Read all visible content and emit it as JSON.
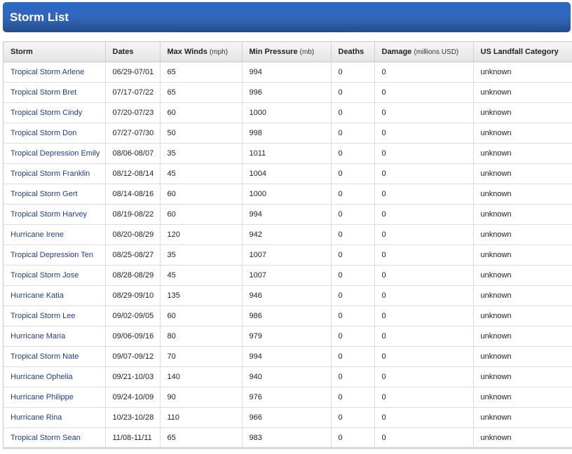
{
  "header": {
    "title": "Storm List"
  },
  "columns": [
    {
      "label": "Storm",
      "unit": ""
    },
    {
      "label": "Dates",
      "unit": ""
    },
    {
      "label": "Max Winds",
      "unit": "(mph)"
    },
    {
      "label": "Min Pressure",
      "unit": "(mb)"
    },
    {
      "label": "Deaths",
      "unit": ""
    },
    {
      "label": "Damage",
      "unit": "(millions USD)"
    },
    {
      "label": "US Landfall Category",
      "unit": ""
    }
  ],
  "rows": [
    {
      "storm": "Tropical Storm Arlene",
      "dates": "06/29-07/01",
      "winds": "65",
      "pressure": "994",
      "deaths": "0",
      "damage": "0",
      "landfall": "unknown"
    },
    {
      "storm": "Tropical Storm Bret",
      "dates": "07/17-07/22",
      "winds": "65",
      "pressure": "996",
      "deaths": "0",
      "damage": "0",
      "landfall": "unknown"
    },
    {
      "storm": "Tropical Storm Cindy",
      "dates": "07/20-07/23",
      "winds": "60",
      "pressure": "1000",
      "deaths": "0",
      "damage": "0",
      "landfall": "unknown"
    },
    {
      "storm": "Tropical Storm Don",
      "dates": "07/27-07/30",
      "winds": "50",
      "pressure": "998",
      "deaths": "0",
      "damage": "0",
      "landfall": "unknown"
    },
    {
      "storm": "Tropical Depression Emily",
      "dates": "08/06-08/07",
      "winds": "35",
      "pressure": "1011",
      "deaths": "0",
      "damage": "0",
      "landfall": "unknown"
    },
    {
      "storm": "Tropical Storm Franklin",
      "dates": "08/12-08/14",
      "winds": "45",
      "pressure": "1004",
      "deaths": "0",
      "damage": "0",
      "landfall": "unknown"
    },
    {
      "storm": "Tropical Storm Gert",
      "dates": "08/14-08/16",
      "winds": "60",
      "pressure": "1000",
      "deaths": "0",
      "damage": "0",
      "landfall": "unknown"
    },
    {
      "storm": "Tropical Storm Harvey",
      "dates": "08/19-08/22",
      "winds": "60",
      "pressure": "994",
      "deaths": "0",
      "damage": "0",
      "landfall": "unknown"
    },
    {
      "storm": "Hurricane Irene",
      "dates": "08/20-08/29",
      "winds": "120",
      "pressure": "942",
      "deaths": "0",
      "damage": "0",
      "landfall": "unknown"
    },
    {
      "storm": "Tropical Depression Ten",
      "dates": "08/25-08/27",
      "winds": "35",
      "pressure": "1007",
      "deaths": "0",
      "damage": "0",
      "landfall": "unknown"
    },
    {
      "storm": "Tropical Storm Jose",
      "dates": "08/28-08/29",
      "winds": "45",
      "pressure": "1007",
      "deaths": "0",
      "damage": "0",
      "landfall": "unknown"
    },
    {
      "storm": "Hurricane Katia",
      "dates": "08/29-09/10",
      "winds": "135",
      "pressure": "946",
      "deaths": "0",
      "damage": "0",
      "landfall": "unknown"
    },
    {
      "storm": "Tropical Storm Lee",
      "dates": "09/02-09/05",
      "winds": "60",
      "pressure": "986",
      "deaths": "0",
      "damage": "0",
      "landfall": "unknown"
    },
    {
      "storm": "Hurricane Maria",
      "dates": "09/06-09/16",
      "winds": "80",
      "pressure": "979",
      "deaths": "0",
      "damage": "0",
      "landfall": "unknown"
    },
    {
      "storm": "Tropical Storm Nate",
      "dates": "09/07-09/12",
      "winds": "70",
      "pressure": "994",
      "deaths": "0",
      "damage": "0",
      "landfall": "unknown"
    },
    {
      "storm": "Hurricane Ophelia",
      "dates": "09/21-10/03",
      "winds": "140",
      "pressure": "940",
      "deaths": "0",
      "damage": "0",
      "landfall": "unknown"
    },
    {
      "storm": "Hurricane Philippe",
      "dates": "09/24-10/09",
      "winds": "90",
      "pressure": "976",
      "deaths": "0",
      "damage": "0",
      "landfall": "unknown"
    },
    {
      "storm": "Hurricane Rina",
      "dates": "10/23-10/28",
      "winds": "110",
      "pressure": "966",
      "deaths": "0",
      "damage": "0",
      "landfall": "unknown"
    },
    {
      "storm": "Tropical Storm Sean",
      "dates": "11/08-11/11",
      "winds": "65",
      "pressure": "983",
      "deaths": "0",
      "damage": "0",
      "landfall": "unknown"
    }
  ],
  "colors": {
    "header_bar": "#2d68c9",
    "link": "#1f3c86"
  }
}
